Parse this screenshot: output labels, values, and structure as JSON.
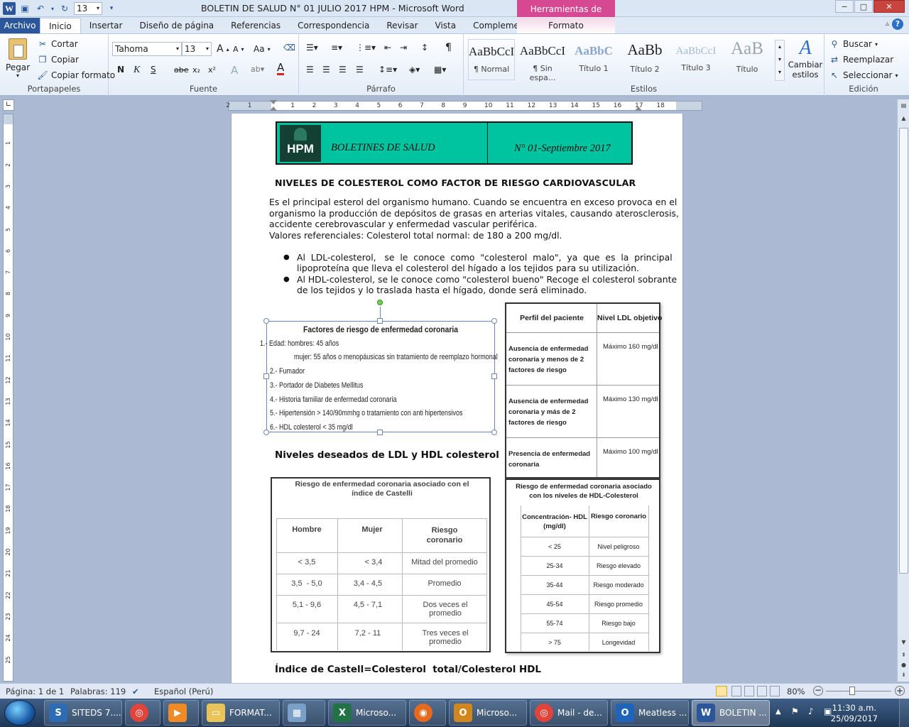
{
  "window": {
    "title": "BOLETIN DE SALUD N° 01 JULIO 2017 HPM  -  Microsoft Word",
    "context_tab": "Herramientas de imagen",
    "qat_font_size": "13",
    "minimize": "−",
    "maximize": "□",
    "close": "✕"
  },
  "tabs": [
    "Archivo",
    "Inicio",
    "Insertar",
    "Diseño de página",
    "Referencias",
    "Correspondencia",
    "Revisar",
    "Vista",
    "Complementos"
  ],
  "context_subtab": "Formato",
  "ribbon": {
    "clipboard": {
      "paste": "Pegar",
      "cut": "Cortar",
      "copy": "Copiar",
      "format_painter": "Copiar formato",
      "label": "Portapapeles"
    },
    "font": {
      "name": "Tahoma",
      "size": "13",
      "label": "Fuente",
      "bold": "N",
      "italic": "K",
      "underline": "S",
      "strike": "abe",
      "sub": "x₂",
      "sup": "x²",
      "grow": "A",
      "shrink": "A",
      "case": "Aa",
      "color_letter": "A"
    },
    "paragraph": {
      "label": "Párrafo",
      "pilcrow": "¶"
    },
    "styles": {
      "label": "Estilos",
      "items": [
        {
          "sample": "AaBbCcI",
          "name": "¶ Normal"
        },
        {
          "sample": "AaBbCcI",
          "name": "¶ Sin espa..."
        },
        {
          "sample": "AaBbC",
          "name": "Título 1"
        },
        {
          "sample": "AaBb",
          "name": "Título 2"
        },
        {
          "sample": "AaBbCcI",
          "name": "Título 3"
        },
        {
          "sample": "AaB",
          "name": "Título"
        }
      ],
      "change": "Cambiar estilos"
    },
    "editing": {
      "label": "Edición",
      "find": "Buscar",
      "replace": "Reemplazar",
      "select": "Seleccionar"
    }
  },
  "ruler": {
    "h_numbers": [
      "2",
      "1",
      "1",
      "2",
      "3",
      "4",
      "5",
      "6",
      "7",
      "8",
      "9",
      "10",
      "11",
      "12",
      "13",
      "14",
      "15",
      "16",
      "17",
      "18"
    ],
    "v_numbers": [
      "1",
      "2",
      "3",
      "4",
      "5",
      "6",
      "7",
      "8",
      "9",
      "10",
      "11",
      "12",
      "13",
      "14",
      "15",
      "16",
      "17",
      "18",
      "19",
      "20",
      "21",
      "22",
      "23",
      "24",
      "25"
    ]
  },
  "document": {
    "header": {
      "logo": "HPM",
      "title": "BOLETINES DE SALUD",
      "issue": "N° 01-Septiembre 2017"
    },
    "heading": "NIVELES DE COLESTEROL COMO FACTOR DE RIESGO CARDIOVASCULAR",
    "paragraph": [
      "Es el principal esterol del organismo humano. Cuando se encuentra en exceso provoca en el",
      "organismo la producción de depósitos de grasas en arterias vitales, causando aterosclerosis,",
      "accidente cerebrovascular y enfermedad vascular periférica.",
      "Valores referenciales: Colesterol total normal: de 180 a 200 mg/dl."
    ],
    "bullets": [
      [
        "Al  LDL-colesterol,   se  le  conoce  como  \"colesterol  malo\",  ya  que  es  la  principal",
        "lipoproteína que lleva el colesterol del hígado a los tejidos para su utilización."
      ],
      [
        "Al HDL-colesterol, se le conoce como \"colesterol bueno\" Recoge el colesterol sobrante",
        "de los tejidos y lo traslada hasta el hígado, donde será eliminado."
      ]
    ],
    "risk_box": {
      "title": "Factores de riesgo de enfermedad coronaria",
      "lines": [
        "1.- Edad: hombres: 45 años",
        "mujer: 55 años o menopáusicas sin tratamiento de reemplazo hormonal",
        "2.- Fumador",
        "3.- Portador de Diabetes Mellitus",
        "4.- Historia familiar de enfermedad coronaria",
        "5.- Hipertensión > 140/90mmhg o tratamiento con anti hipertensivos",
        "6.- HDL colesterol < 35 mg/dl"
      ]
    },
    "ldl_table": {
      "headers": [
        "Perfil del paciente",
        "Nivel LDL objetivo"
      ],
      "rows": [
        [
          "Ausencia de enfermedad coronaria y menos de 2 factores de riesgo",
          "Máximo 160 mg/dl"
        ],
        [
          "Ausencia de enfermedad coronaria y más de 2 factores de riesgo",
          "Máximo 130 mg/dl"
        ],
        [
          "Presencia de enfermedad coronaria",
          "Máximo 100 mg/dl"
        ]
      ]
    },
    "subheading": "Niveles deseados de LDL y HDL colesterol",
    "castelli": {
      "title": "Riesgo de enfermedad coronaria asociado con el índice de Castelli",
      "headers": [
        "Hombre",
        "Mujer",
        "Riesgo coronario"
      ],
      "rows": [
        [
          "< 3,5",
          "< 3,4",
          "Mitad del promedio"
        ],
        [
          "3,5  - 5,0",
          "3,4 - 4,5",
          "Promedio"
        ],
        [
          "5,1 - 9,6",
          "4,5 - 7,1",
          "Dos veces el promedio"
        ],
        [
          "9,7 - 24",
          "7,2 - 11",
          "Tres veces el promedio"
        ]
      ]
    },
    "hdl_table": {
      "title": "Riesgo de enfermedad coronaria asociado con los niveles de HDL-Colesterol",
      "headers": [
        "Concentración- HDL (mg/dl)",
        "Riesgo coronario"
      ],
      "rows": [
        [
          "< 25",
          "Nivel peligroso"
        ],
        [
          "25-34",
          "Riesgo elevado"
        ],
        [
          "35-44",
          "Riesgo moderado"
        ],
        [
          "45-54",
          "Riesgo promedio"
        ],
        [
          "55-74",
          "Riesgo bajo"
        ],
        [
          "> 75",
          "Longevidad"
        ]
      ]
    },
    "formula": "Índice de Castell=Colesterol  total/Colesterol HDL"
  },
  "status": {
    "page": "Página: 1 de 1",
    "words": "Palabras: 119",
    "language": "Español (Perú)",
    "zoom": "80%"
  },
  "taskbar": {
    "items": [
      {
        "label": "SITEDS 7....",
        "color": "#2d6bb3"
      },
      {
        "label": "",
        "color": "#e0443a"
      },
      {
        "label": "",
        "color": "#f08a24"
      },
      {
        "label": "FORMAT...",
        "color": "#e9c45a"
      },
      {
        "label": "",
        "color": "#7aa0c8"
      },
      {
        "label": "Microso...",
        "color": "#217346"
      },
      {
        "label": "",
        "color": "#e66a1e"
      },
      {
        "label": "Microso...",
        "color": "#d2861e"
      },
      {
        "label": "Mail - de...",
        "color": "#e0443a"
      },
      {
        "label": "Meatless ...",
        "color": "#1e64b8"
      },
      {
        "label": "BOLETIN ...",
        "color": "#2b579a"
      }
    ],
    "time": "11:30 a.m.",
    "date": "25/09/2017"
  }
}
